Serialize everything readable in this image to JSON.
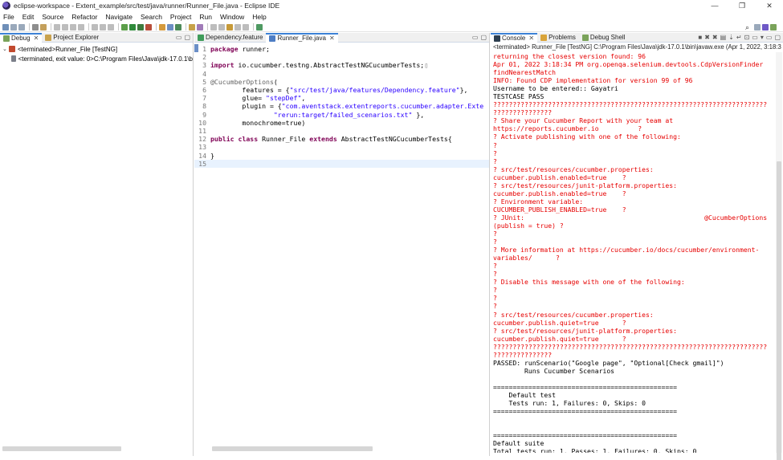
{
  "window": {
    "title": "eclipse-workspace - Extent_example/src/test/java/runner/Runner_File.java - Eclipse IDE",
    "controls": {
      "minimize": "—",
      "restore": "❐",
      "close": "✕"
    }
  },
  "menubar": {
    "items": [
      "File",
      "Edit",
      "Source",
      "Refactor",
      "Navigate",
      "Search",
      "Project",
      "Run",
      "Window",
      "Help"
    ]
  },
  "toolbar": {
    "search_icon": "magnifier-icon"
  },
  "debug_view": {
    "tabs": [
      {
        "label": "Debug",
        "active": true,
        "close": "✕"
      },
      {
        "label": "Project Explorer",
        "active": false
      }
    ],
    "tree": [
      {
        "toggle": "⌄",
        "label": "<terminated>Runner_File [TestNG]"
      },
      {
        "toggle": "",
        "label": "<terminated, exit value: 0>C:\\Program Files\\Java\\jdk-17.0.1\\b"
      }
    ]
  },
  "editor": {
    "tabs": [
      {
        "label": "Dependency.feature",
        "active": false
      },
      {
        "label": "Runner_File.java",
        "active": true,
        "close": "✕"
      }
    ],
    "lines": [
      {
        "n": "1",
        "fold": "",
        "parts": [
          [
            "kw",
            "package"
          ],
          [
            "",
            " runner;"
          ]
        ]
      },
      {
        "n": "2",
        "fold": "",
        "parts": []
      },
      {
        "n": "3",
        "fold": "⊕",
        "parts": [
          [
            "kw",
            "import"
          ],
          [
            "",
            " io.cucumber.testng.AbstractTestNGCucumberTests;"
          ],
          [
            "fold",
            "▯"
          ]
        ]
      },
      {
        "n": "4",
        "fold": "",
        "parts": []
      },
      {
        "n": "5",
        "fold": "",
        "parts": [
          [
            "ann",
            "@CucumberOptions"
          ],
          [
            "",
            "("
          ]
        ]
      },
      {
        "n": "6",
        "fold": "",
        "parts": [
          [
            "",
            "        features = {"
          ],
          [
            "str",
            "\"src/test/java/features/Dependency.feature\""
          ],
          [
            "",
            "},"
          ]
        ]
      },
      {
        "n": "7",
        "fold": "",
        "parts": [
          [
            "",
            "        glue= "
          ],
          [
            "str",
            "\"stepDef\""
          ],
          [
            "",
            ","
          ]
        ]
      },
      {
        "n": "8",
        "fold": "",
        "parts": [
          [
            "",
            "        plugin = {"
          ],
          [
            "str",
            "\"com.aventstack.extentreports.cucumber.adapter.Exte"
          ]
        ]
      },
      {
        "n": "9",
        "fold": "",
        "parts": [
          [
            "",
            "                "
          ],
          [
            "str",
            "\"rerun:target/failed_scenarios.txt\""
          ],
          [
            "",
            " },"
          ]
        ]
      },
      {
        "n": "10",
        "fold": "",
        "parts": [
          [
            "",
            "        monochrome=true)"
          ]
        ]
      },
      {
        "n": "11",
        "fold": "",
        "parts": []
      },
      {
        "n": "12",
        "fold": "",
        "parts": [
          [
            "kw",
            "public"
          ],
          [
            "",
            " "
          ],
          [
            "kw",
            "class"
          ],
          [
            "",
            " Runner_File "
          ],
          [
            "kw",
            "extends"
          ],
          [
            "",
            " AbstractTestNGCucumberTests{"
          ]
        ]
      },
      {
        "n": "13",
        "fold": "",
        "parts": []
      },
      {
        "n": "14",
        "fold": "",
        "parts": [
          [
            "",
            "}"
          ]
        ]
      },
      {
        "n": "15",
        "fold": "",
        "parts": []
      }
    ]
  },
  "console_view": {
    "tabs": [
      {
        "label": "Console",
        "active": true,
        "close": "✕"
      },
      {
        "label": "Problems",
        "active": false
      },
      {
        "label": "Debug Shell",
        "active": false
      }
    ],
    "header": "<terminated> Runner_File [TestNG] C:\\Program Files\\Java\\jdk-17.0.1\\bin\\javaw.exe  (Apr 1, 2022, 3:18:3",
    "lines": [
      {
        "t": "err",
        "s": "returning the closest version found: 96"
      },
      {
        "t": "err",
        "s": "Apr 01, 2022 3:18:34 PM org.openqa.selenium.devtools.CdpVersionFinder"
      },
      {
        "t": "err",
        "s": "findNearestMatch"
      },
      {
        "t": "err",
        "s": "INFO: Found CDP implementation for version 99 of 96"
      },
      {
        "t": "out",
        "s": "Username to be entered:: Gayatri"
      },
      {
        "t": "out",
        "s": "TESTCASE PASS"
      },
      {
        "t": "err",
        "s": "??????????????????????????????????????????????????????????????????????"
      },
      {
        "t": "err",
        "s": "???????????????"
      },
      {
        "t": "err",
        "s": "? Share your Cucumber Report with your team at"
      },
      {
        "t": "err",
        "s": "https://reports.cucumber.io          ?"
      },
      {
        "t": "err",
        "s": "? Activate publishing with one of the following:"
      },
      {
        "t": "err",
        "s": "?"
      },
      {
        "t": "err",
        "s": "?"
      },
      {
        "t": "err",
        "s": "?"
      },
      {
        "t": "err",
        "s": "? src/test/resources/cucumber.properties:"
      },
      {
        "t": "err",
        "s": "cucumber.publish.enabled=true    ?"
      },
      {
        "t": "err",
        "s": "? src/test/resources/junit-platform.properties:"
      },
      {
        "t": "err",
        "s": "cucumber.publish.enabled=true    ?"
      },
      {
        "t": "err",
        "s": "? Environment variable:"
      },
      {
        "t": "err",
        "s": "CUCUMBER_PUBLISH_ENABLED=true    ?"
      },
      {
        "t": "err",
        "s": "? JUnit:                                              @CucumberOptions"
      },
      {
        "t": "err",
        "s": "(publish = true) ?"
      },
      {
        "t": "err",
        "s": "?"
      },
      {
        "t": "err",
        "s": "?"
      },
      {
        "t": "err",
        "s": "? More information at https://cucumber.io/docs/cucumber/environment-"
      },
      {
        "t": "err",
        "s": "variables/      ?"
      },
      {
        "t": "err",
        "s": "?"
      },
      {
        "t": "err",
        "s": "?"
      },
      {
        "t": "err",
        "s": "? Disable this message with one of the following:"
      },
      {
        "t": "err",
        "s": "?"
      },
      {
        "t": "err",
        "s": "?"
      },
      {
        "t": "err",
        "s": "?"
      },
      {
        "t": "err",
        "s": "? src/test/resources/cucumber.properties:"
      },
      {
        "t": "err",
        "s": "cucumber.publish.quiet=true      ?"
      },
      {
        "t": "err",
        "s": "? src/test/resources/junit-platform.properties:"
      },
      {
        "t": "err",
        "s": "cucumber.publish.quiet=true      ?"
      },
      {
        "t": "err",
        "s": "??????????????????????????????????????????????????????????????????????"
      },
      {
        "t": "err",
        "s": "???????????????"
      },
      {
        "t": "out",
        "s": "PASSED: runScenario(\"Google page\", \"Optional[Check gmail]\")"
      },
      {
        "t": "out",
        "s": "        Runs Cucumber Scenarios"
      },
      {
        "t": "out",
        "s": ""
      },
      {
        "t": "out",
        "s": "==============================================="
      },
      {
        "t": "out",
        "s": "    Default test"
      },
      {
        "t": "out",
        "s": "    Tests run: 1, Failures: 0, Skips: 0"
      },
      {
        "t": "out",
        "s": "==============================================="
      },
      {
        "t": "out",
        "s": ""
      },
      {
        "t": "out",
        "s": ""
      },
      {
        "t": "out",
        "s": "==============================================="
      },
      {
        "t": "out",
        "s": "Default suite"
      },
      {
        "t": "out",
        "s": "Total tests run: 1, Passes: 1, Failures: 0, Skips: 0"
      },
      {
        "t": "out",
        "s": "==============================================="
      }
    ]
  },
  "colors": {
    "keyword": "#7f0055",
    "string": "#2a00ff",
    "annotation": "#646464",
    "stderr": "#e60000",
    "active_tab_accent": "#3c82d6"
  }
}
